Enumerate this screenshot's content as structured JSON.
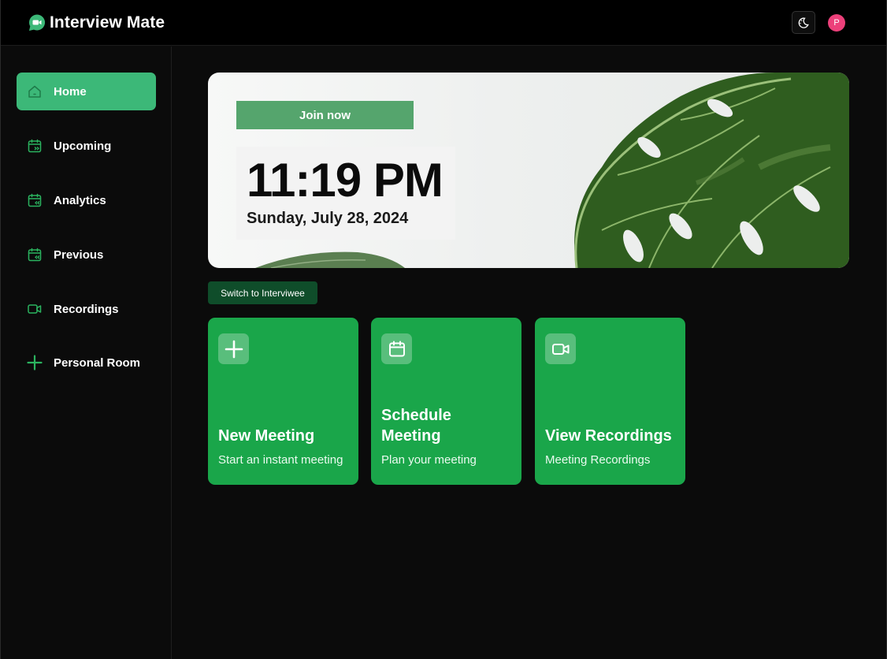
{
  "app": {
    "title": "Interview Mate"
  },
  "header": {
    "avatar_initial": "P"
  },
  "sidebar": {
    "items": [
      {
        "label": "Home",
        "icon": "home-icon",
        "active": true
      },
      {
        "label": "Upcoming",
        "icon": "calendar-forward-icon",
        "active": false
      },
      {
        "label": "Analytics",
        "icon": "calendar-back-icon",
        "active": false
      },
      {
        "label": "Previous",
        "icon": "calendar-back-icon",
        "active": false
      },
      {
        "label": "Recordings",
        "icon": "video-icon",
        "active": false
      },
      {
        "label": "Personal Room",
        "icon": "plus-icon",
        "active": false
      }
    ]
  },
  "hero": {
    "join_label": "Join now",
    "time": "11:19 PM",
    "date": "Sunday, July 28, 2024"
  },
  "switch_label": "Switch to Interviwee",
  "cards": [
    {
      "title": "New Meeting",
      "subtitle": "Start an instant meeting",
      "icon": "plus-icon"
    },
    {
      "title": "Schedule Meeting",
      "subtitle": "Plan your meeting",
      "icon": "calendar-icon"
    },
    {
      "title": "View Recordings",
      "subtitle": "Meeting Recordings",
      "icon": "video-icon"
    }
  ],
  "colors": {
    "accent": "#3cb878",
    "card": "#1aa64a",
    "switch_button": "#0f4d2a",
    "avatar": "#ec407a"
  }
}
